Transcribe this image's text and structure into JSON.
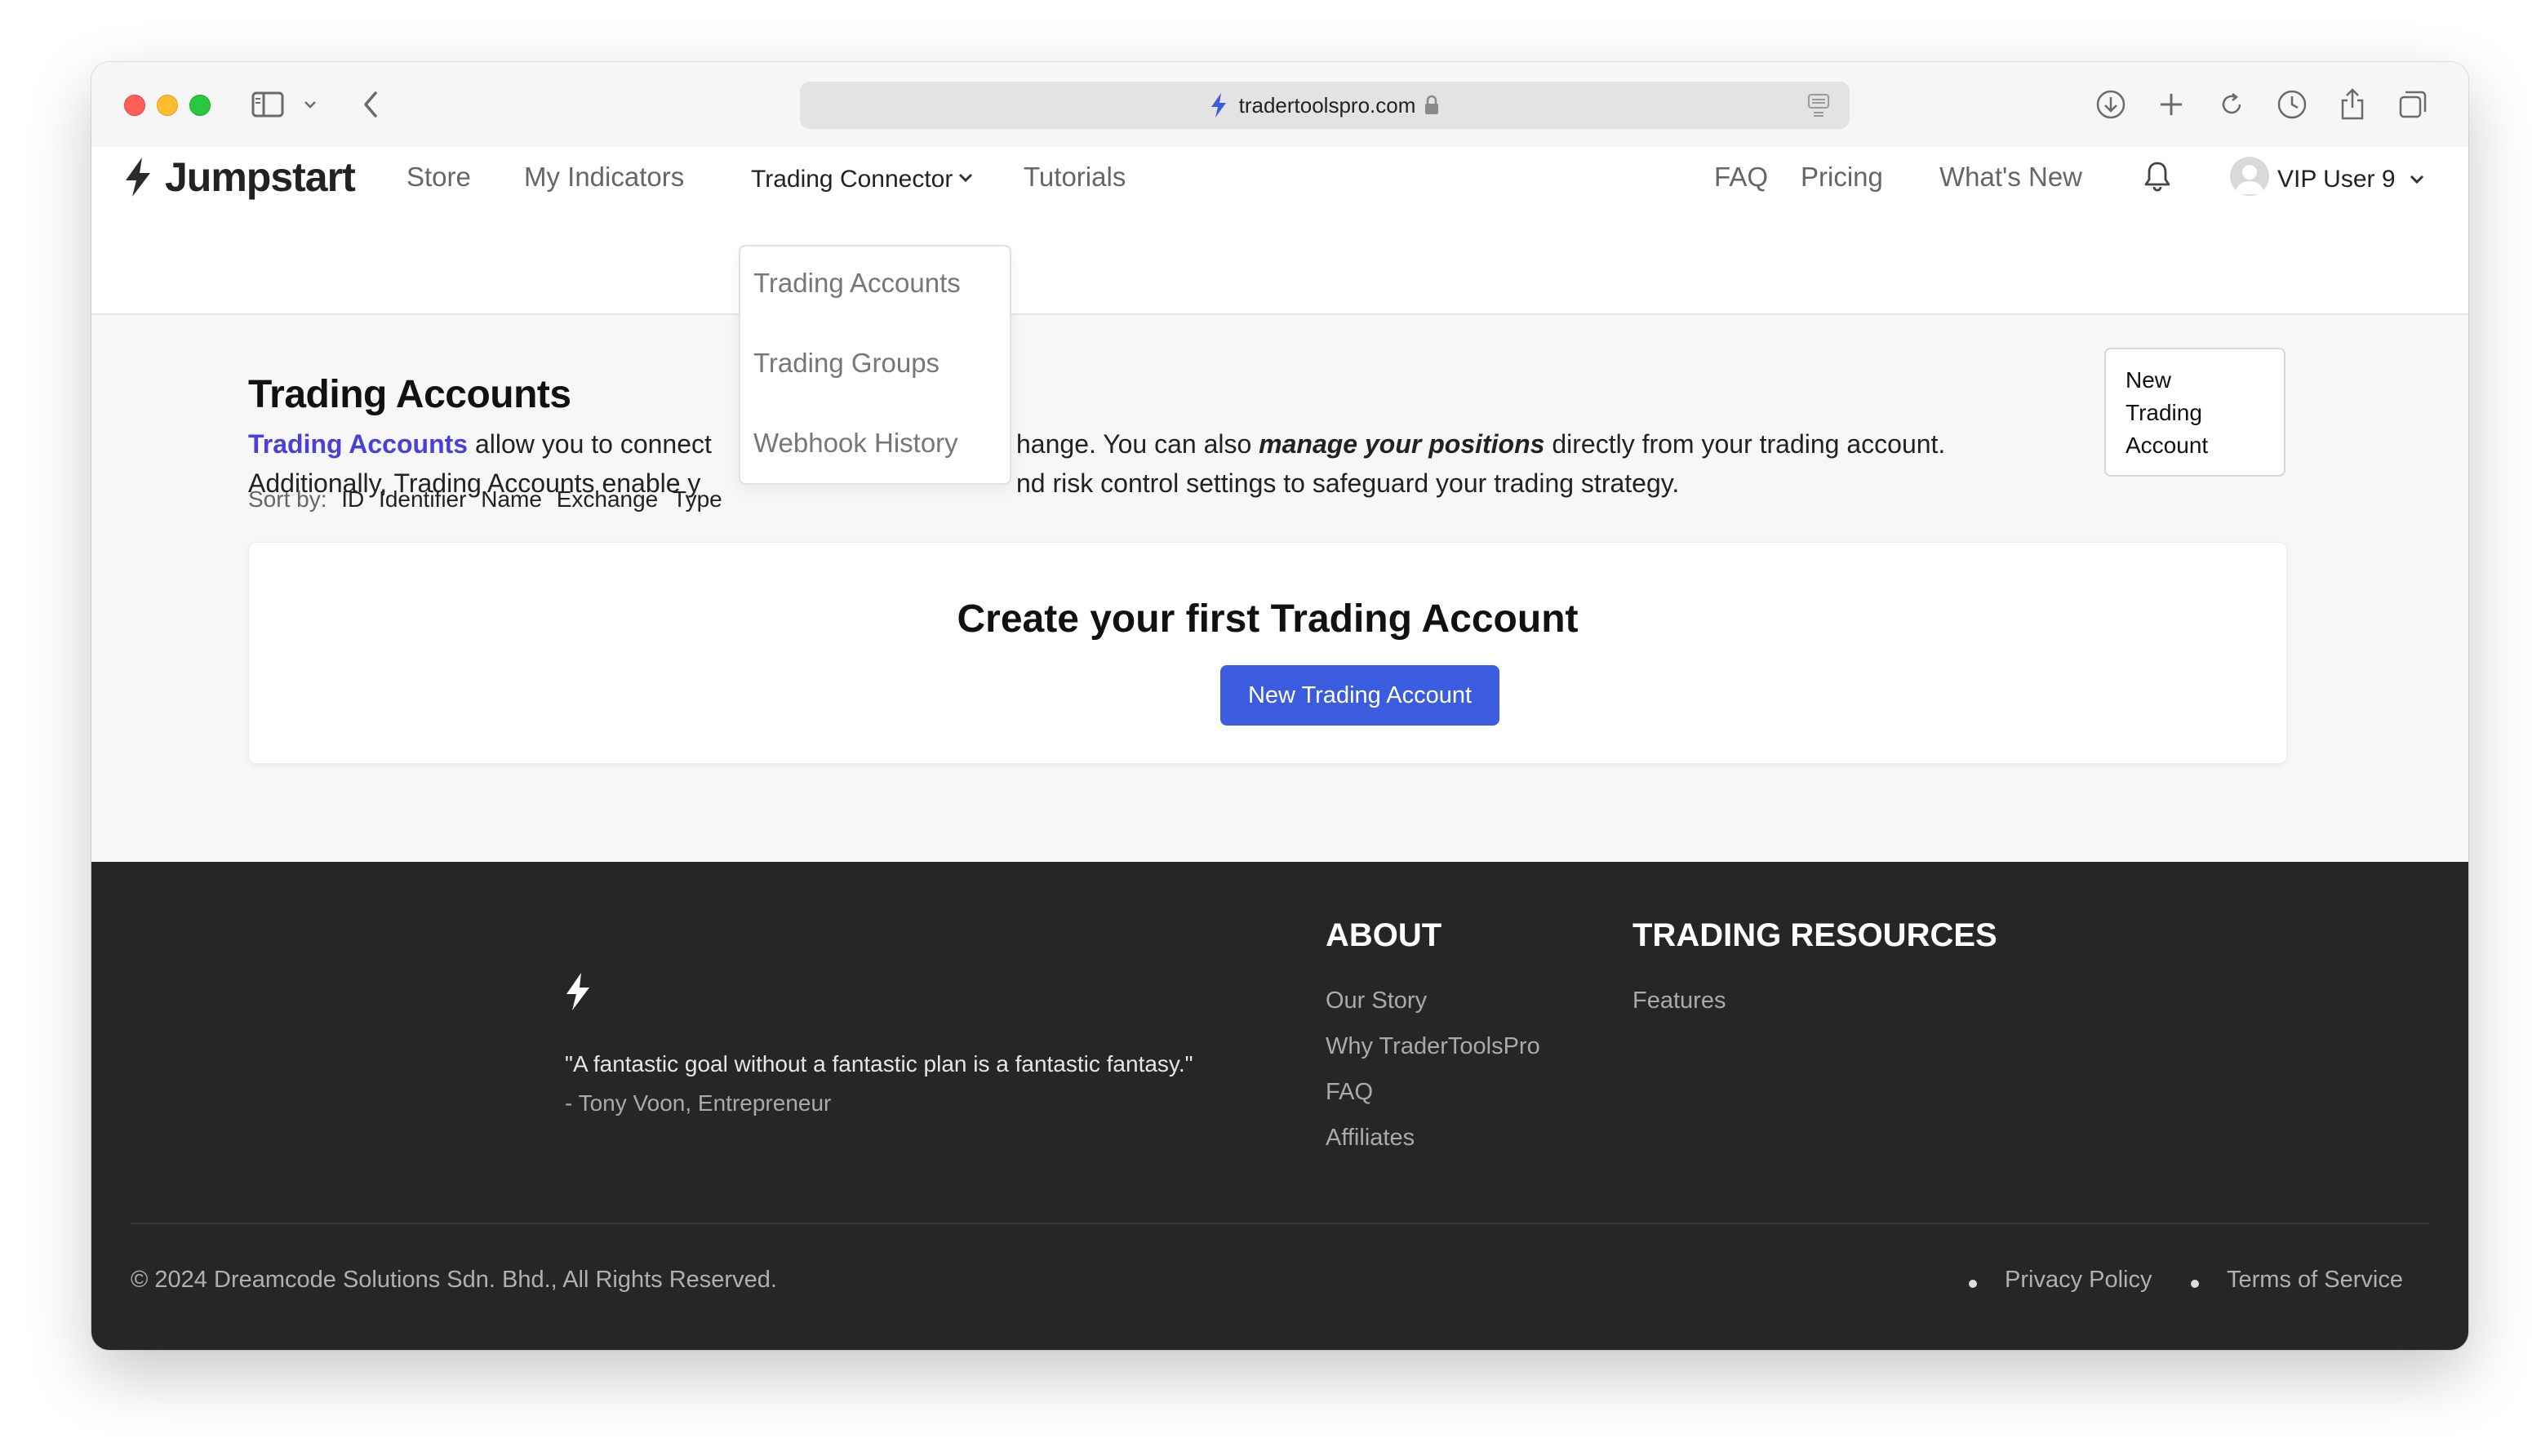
{
  "browser": {
    "url": "tradertoolspro.com"
  },
  "nav": {
    "logo_text": "Jumpstart",
    "store": "Store",
    "my_indicators": "My Indicators",
    "trading_connector": "Trading Connector",
    "tutorials": "Tutorials",
    "faq": "FAQ",
    "pricing": "Pricing",
    "whats_new": "What's New",
    "user": "VIP User 9"
  },
  "dropdown": {
    "items": [
      "Trading Accounts",
      "Trading Groups",
      "Webhook History"
    ]
  },
  "page": {
    "title": "Trading Accounts",
    "desc_link": "Trading Accounts",
    "desc_1a": " allow you to connect",
    "desc_1b": "hange. You can also ",
    "desc_1_em": "manage your positions",
    "desc_1c": " directly from your trading account.",
    "desc_2a": "Additionally, Trading Accounts enable y",
    "desc_2b": "nd risk control settings to safeguard your trading strategy.",
    "new_button_lines": [
      "New",
      "Trading",
      "Account"
    ],
    "sort_label": "Sort by:",
    "sort_options": [
      "ID",
      "Identifier",
      "Name",
      "Exchange",
      "Type"
    ]
  },
  "empty_state": {
    "title": "Create your first Trading Account",
    "button": "New Trading Account"
  },
  "footer": {
    "quote": "\"A fantastic goal without a fantastic plan is a fantastic fantasy.\"",
    "quote_author": "- Tony Voon, Entrepreneur",
    "about_heading": "ABOUT",
    "about_links": [
      "Our Story",
      "Why TraderToolsPro",
      "FAQ",
      "Affiliates"
    ],
    "resources_heading": "TRADING RESOURCES",
    "resources_links": [
      "Features"
    ],
    "copyright": "© 2024 Dreamcode Solutions Sdn. Bhd., All Rights Reserved.",
    "privacy": "Privacy Policy",
    "terms": "Terms of Service"
  },
  "colors": {
    "accent": "#3b5cde",
    "link": "#4a40d8",
    "footer_bg": "#262626"
  }
}
